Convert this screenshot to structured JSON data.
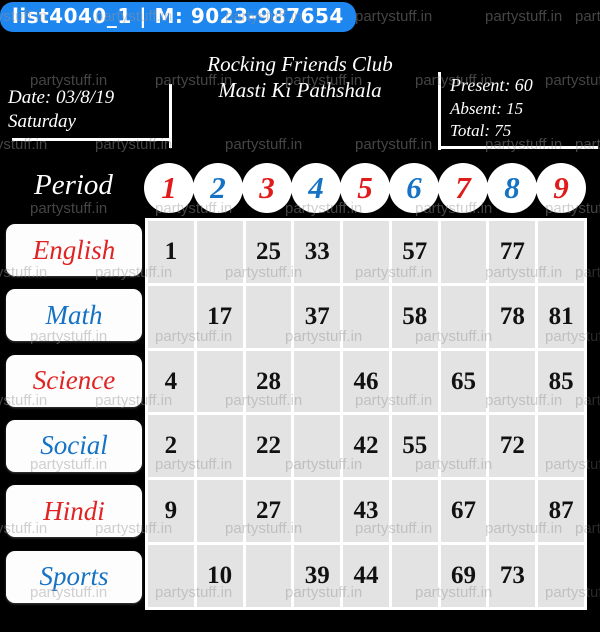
{
  "badge": {
    "text": "list4040_1 | M: 9023-987654",
    "bg_color": "#1e86ef",
    "text_color": "#ffffff"
  },
  "header": {
    "left": {
      "date_line": "Date: 03/8/19",
      "day_line": "Saturday"
    },
    "center": {
      "club_name": "Rocking Friends Club",
      "subtitle": "Masti Ki Pathshala"
    },
    "right": {
      "present": "Present: 60",
      "absent": "Absent: 15",
      "total": "Total: 75"
    }
  },
  "period": {
    "label": "Period",
    "numbers": [
      {
        "value": "1",
        "color": "red"
      },
      {
        "value": "2",
        "color": "blue"
      },
      {
        "value": "3",
        "color": "red"
      },
      {
        "value": "4",
        "color": "blue"
      },
      {
        "value": "5",
        "color": "red"
      },
      {
        "value": "6",
        "color": "blue"
      },
      {
        "value": "7",
        "color": "red"
      },
      {
        "value": "8",
        "color": "blue"
      },
      {
        "value": "9",
        "color": "red"
      }
    ]
  },
  "rows": [
    {
      "label": "English",
      "color": "red",
      "values": [
        "1",
        "",
        "25",
        "33",
        "",
        "57",
        "",
        "77",
        ""
      ]
    },
    {
      "label": "Math",
      "color": "blue",
      "values": [
        "",
        "17",
        "",
        "37",
        "",
        "58",
        "",
        "78",
        "81"
      ]
    },
    {
      "label": "Science",
      "color": "red",
      "values": [
        "4",
        "",
        "28",
        "",
        "46",
        "",
        "65",
        "",
        "85"
      ]
    },
    {
      "label": "Social",
      "color": "blue",
      "values": [
        "2",
        "",
        "22",
        "",
        "42",
        "55",
        "",
        "72",
        ""
      ]
    },
    {
      "label": "Hindi",
      "color": "red",
      "values": [
        "9",
        "",
        "27",
        "",
        "43",
        "",
        "67",
        "",
        "87"
      ]
    },
    {
      "label": "Sports",
      "color": "blue",
      "values": [
        "",
        "10",
        "",
        "39",
        "44",
        "",
        "69",
        "73",
        ""
      ]
    }
  ],
  "watermark": {
    "text": "partystuff.in"
  },
  "colors": {
    "accent_red": "#e01b1b",
    "accent_blue": "#1572c4",
    "badge_blue": "#1e86ef",
    "cell_gray": "#e3e3e3",
    "background": "#000000"
  }
}
